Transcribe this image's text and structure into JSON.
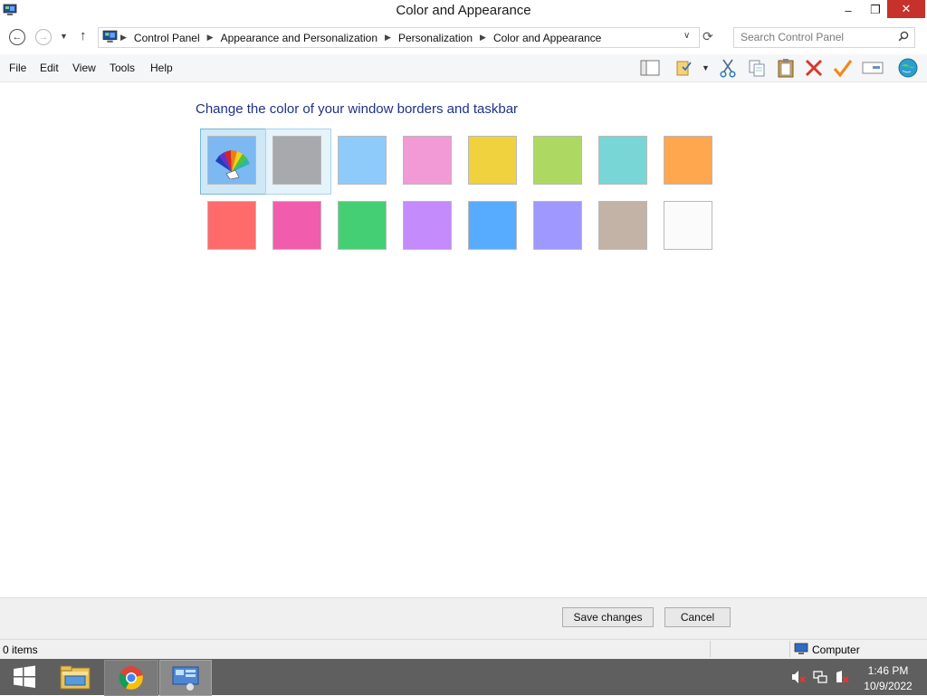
{
  "window": {
    "title": "Color and Appearance",
    "app_icon": "control-panel-icon",
    "controls": {
      "minimize": "–",
      "maximize": "❐",
      "close": "✕"
    }
  },
  "address": {
    "breadcrumbs": [
      "Control Panel",
      "Appearance and Personalization",
      "Personalization",
      "Color and Appearance"
    ],
    "search_placeholder": "Search Control Panel"
  },
  "menu": [
    "File",
    "Edit",
    "View",
    "Tools",
    "Help"
  ],
  "toolbar_icons": [
    "layout-icon",
    "properties-icon",
    "dropdown-icon",
    "cut-icon",
    "copy-icon",
    "paste-icon",
    "delete-icon",
    "checkmark-icon",
    "rename-icon",
    "web-icon"
  ],
  "content": {
    "heading": "Change the color of your window borders and taskbar",
    "swatches_row1": [
      {
        "name": "automatic",
        "color": "#7cb8f2",
        "selected": true
      },
      {
        "name": "gray",
        "color": "#a7a9ac",
        "hovered": true
      },
      {
        "name": "sky",
        "color": "#8ecbfb"
      },
      {
        "name": "pink",
        "color": "#f29ad6"
      },
      {
        "name": "yellow",
        "color": "#f0d13e"
      },
      {
        "name": "lime",
        "color": "#add962"
      },
      {
        "name": "teal",
        "color": "#79d6d6"
      },
      {
        "name": "orange",
        "color": "#ffa74f"
      }
    ],
    "swatches_row2": [
      {
        "name": "red",
        "color": "#ff6b6b"
      },
      {
        "name": "magenta",
        "color": "#f15cad"
      },
      {
        "name": "green",
        "color": "#44cf74"
      },
      {
        "name": "violet",
        "color": "#c38bfb"
      },
      {
        "name": "blue",
        "color": "#58acff"
      },
      {
        "name": "periwinkle",
        "color": "#9e98ff"
      },
      {
        "name": "taupe",
        "color": "#c2b3a6"
      },
      {
        "name": "white",
        "color": "#fbfbfb"
      }
    ]
  },
  "buttons": {
    "save": "Save changes",
    "cancel": "Cancel"
  },
  "status": {
    "items": "0 items",
    "location": "Computer"
  },
  "taskbar": {
    "apps": [
      "windows-start-icon",
      "file-explorer-icon",
      "chrome-icon",
      "control-panel-icon"
    ],
    "tray_icons": [
      "volume-muted-icon",
      "network-icon",
      "action-center-icon"
    ],
    "time": "1:46 PM",
    "date": "10/9/2022"
  }
}
